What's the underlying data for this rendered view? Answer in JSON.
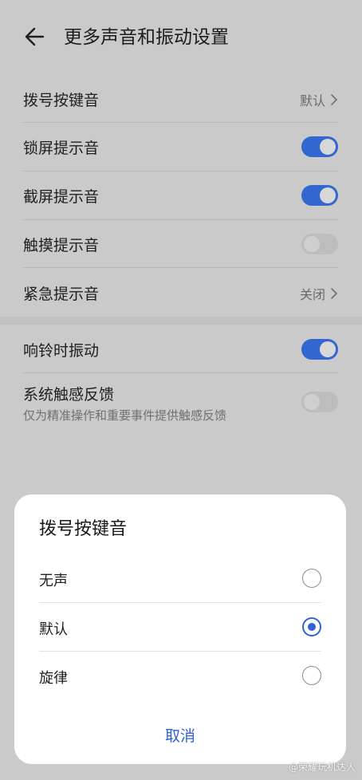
{
  "header": {
    "title": "更多声音和振动设置"
  },
  "settings": {
    "dial_tone": {
      "label": "拨号按键音",
      "value": "默认"
    },
    "lock_screen": {
      "label": "锁屏提示音",
      "on": true
    },
    "screenshot": {
      "label": "截屏提示音",
      "on": true
    },
    "touch": {
      "label": "触摸提示音",
      "on": false
    },
    "emergency": {
      "label": "紧急提示音",
      "value": "关闭"
    },
    "ring_vibrate": {
      "label": "响铃时振动",
      "on": true
    },
    "haptic": {
      "label": "系统触感反馈",
      "sub": "仅为精准操作和重要事件提供触感反馈",
      "on": false
    }
  },
  "dialog": {
    "title": "拨号按键音",
    "options": [
      {
        "label": "无声",
        "selected": false
      },
      {
        "label": "默认",
        "selected": true
      },
      {
        "label": "旋律",
        "selected": false
      }
    ],
    "cancel": "取消"
  },
  "watermark": "@荣耀玩机达人",
  "colors": {
    "accent": "#3266d0",
    "background": "#cacaca",
    "sheet": "#ffffff"
  }
}
